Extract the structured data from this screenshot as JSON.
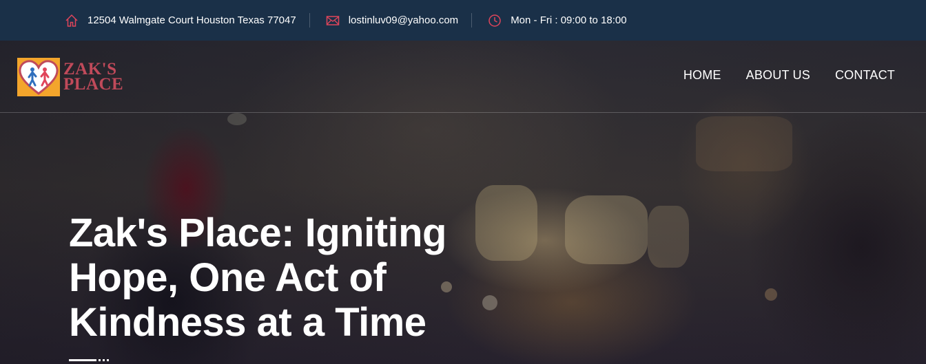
{
  "topbar": {
    "address": "12504 Walmgate Court Houston Texas 77047",
    "email": "lostinluv09@yahoo.com",
    "hours": "Mon - Fri : 09:00 to 18:00",
    "icons": {
      "address": "home-icon",
      "email": "envelope-icon",
      "hours": "clock-icon"
    },
    "icon_color": "#e0455b"
  },
  "logo": {
    "line1": "ZAK'S",
    "line2": "PLACE",
    "brand_color": "#c04a5a",
    "badge_color": "#f3a52c"
  },
  "nav": {
    "items": [
      {
        "label": "HOME"
      },
      {
        "label": "ABOUT US"
      },
      {
        "label": "CONTACT"
      }
    ]
  },
  "hero": {
    "title_lines": [
      "Zak's Place: Igniting",
      "Hope, One Act of",
      "Kindness at a Time"
    ]
  }
}
